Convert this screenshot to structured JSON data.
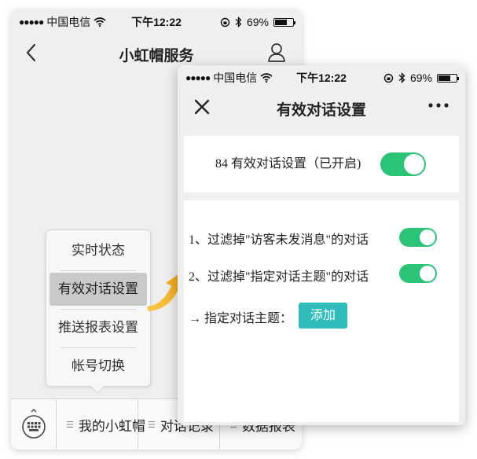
{
  "status_bar": {
    "carrier": "中国电信",
    "time": "下午12:22",
    "battery": "69%",
    "battery_level": 0.69
  },
  "back_screen": {
    "title": "小虹帽服务",
    "popup_menu": {
      "items": [
        {
          "label": "实时状态",
          "active": false
        },
        {
          "label": "有效对话设置",
          "active": true
        },
        {
          "label": "推送报表设置",
          "active": false
        },
        {
          "label": "帐号切换",
          "active": false
        }
      ]
    },
    "bottom_tabs": [
      {
        "label": "我的小虹帽"
      },
      {
        "label": "对话记录"
      },
      {
        "label": "数据报表"
      }
    ]
  },
  "front_screen": {
    "title": "有效对话设置",
    "main_setting": {
      "count": "84",
      "label": "有效对话设置（已开启)",
      "enabled": true
    },
    "rules": [
      {
        "label": "1、过滤掉\"访客未发消息\"的对话",
        "enabled": true
      },
      {
        "label": "2、过滤掉\"指定对话主题\"的对话",
        "enabled": true
      }
    ],
    "topic_label": "→  指定对话主题：",
    "add_button": "添加"
  },
  "colors": {
    "toggle_on": "#2ac477",
    "add_button": "#2fbdbb",
    "arrow": "#f5b21b",
    "menu_active": "#c9c9c9"
  },
  "icons": {
    "back": "chevron-left-icon",
    "user": "user-icon",
    "close": "close-icon",
    "more": "more-icon",
    "keyboard": "keyboard-icon",
    "wifi": "wifi-icon",
    "bluetooth": "bluetooth-icon",
    "rotation_lock": "rotation-lock-icon",
    "signal": "signal-dots-icon"
  }
}
